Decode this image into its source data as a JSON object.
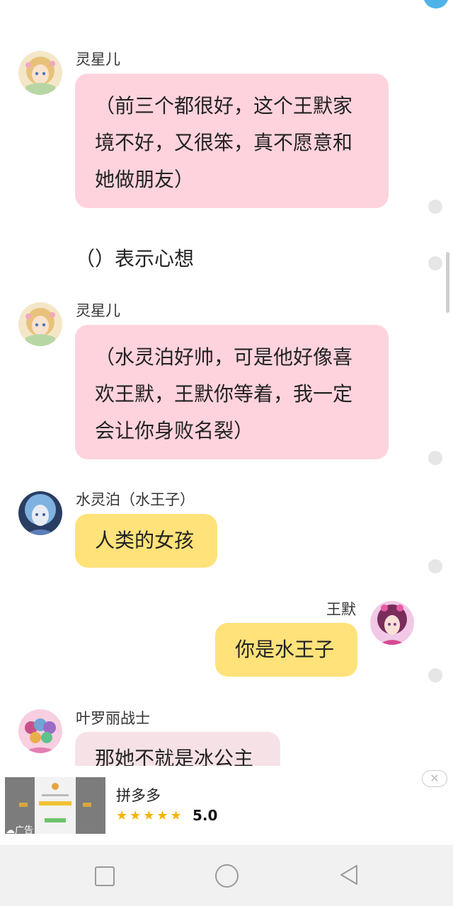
{
  "messages": [
    {
      "sender": "灵星儿",
      "text": "（前三个都很好，这个王默家境不好，又很笨，真不愿意和她做朋友）",
      "lines": [
        "（前三个都很好，这个王默家",
        "境不好，又很笨，真不愿意和",
        "她做朋友）"
      ],
      "side": "left",
      "bubble_color": "#ffd3de",
      "avatar": "anime-girl-blonde-avatar"
    },
    {
      "note": "（）表示心想"
    },
    {
      "sender": "灵星儿",
      "text": "（水灵泊好帅，可是他好像喜欢王默，王默你等着，我一定会让你身败名裂）",
      "lines": [
        "（水灵泊好帅，可是他好像喜",
        "欢王默，王默你等着，我一定",
        "会让你身败名裂）"
      ],
      "side": "left",
      "bubble_color": "#ffd3de",
      "avatar": "anime-girl-blonde-avatar"
    },
    {
      "sender": "水灵泊（水王子）",
      "text": "人类的女孩",
      "side": "left",
      "bubble_color": "#ffe27a",
      "avatar": "water-prince-avatar"
    },
    {
      "sender": "王默",
      "text": "你是水王子",
      "side": "right",
      "bubble_color": "#ffe27a",
      "avatar": "pink-hair-girl-avatar"
    },
    {
      "sender": "叶罗丽战士",
      "text": "那她不就是冰公主",
      "side": "left",
      "bubble_color": "#f6e2e6",
      "avatar": "group-fairies-avatar"
    }
  ],
  "ad": {
    "label": "广告",
    "title": "拼多多",
    "stars": "★★★★★",
    "rating": "5.0",
    "close_icon": "close-icon"
  },
  "navbar": {
    "icons": [
      "recent-apps-icon",
      "home-icon",
      "back-icon"
    ]
  },
  "colors": {
    "pink_bubble": "#ffd3de",
    "yellow_bubble": "#ffe27a",
    "accent_blue": "#4fb3ea"
  }
}
